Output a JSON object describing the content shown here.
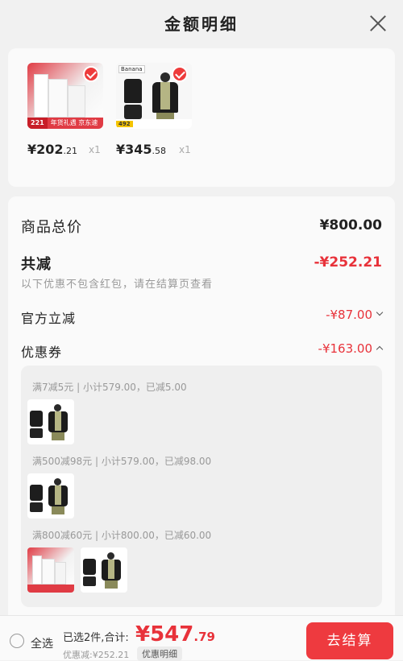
{
  "header": {
    "title": "金额明细"
  },
  "products": [
    {
      "price_main": "¥202",
      "price_dec": ".21",
      "qty": "x1",
      "sticker": "年货礼遇 京东速达",
      "badge": "221"
    },
    {
      "price_main": "¥345",
      "price_dec": ".58",
      "qty": "x1",
      "brand": "Banana",
      "badge": "492"
    }
  ],
  "detail": {
    "goods_total_label": "商品总价",
    "goods_total_value": "¥800.00",
    "discount_label": "共减",
    "discount_value": "-¥252.21",
    "note": "以下优惠不包含红包，请在结算页查看",
    "official_label": "官方立减",
    "official_value": "-¥87.00",
    "coupon_label": "优惠券",
    "coupon_value": "-¥163.00"
  },
  "coupons": [
    {
      "rule": "满7减5元 | 小计579.00，已减5.00"
    },
    {
      "rule": "满500减98元 | 小计579.00，已减98.00"
    },
    {
      "rule": "满800减60元 | 小计800.00，已减60.00"
    }
  ],
  "footer": {
    "select_all": "全选",
    "summary": "已选2件,合计:",
    "total_main": "¥547",
    "total_dec": ".79",
    "discount_text": "优惠减:¥252.21",
    "detail_btn": "优惠明细",
    "checkout": "去结算"
  },
  "colors": {
    "accent": "#e8323a",
    "checkout_bg": "#ee3a3f"
  }
}
